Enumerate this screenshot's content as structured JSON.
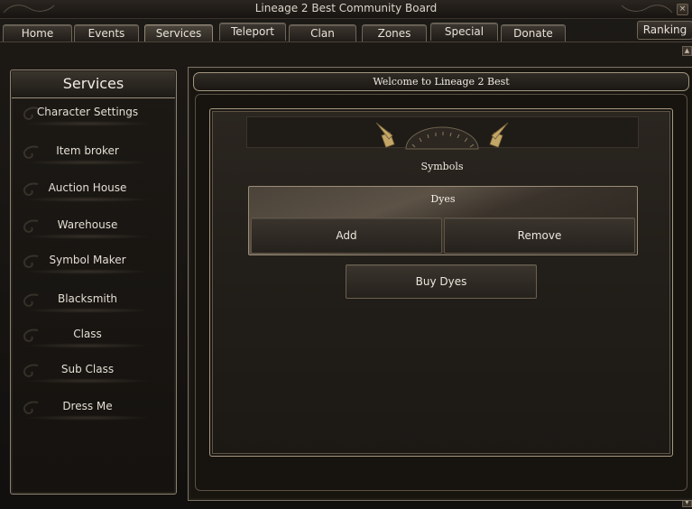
{
  "window": {
    "title": "Lineage 2 Best Community Board"
  },
  "tabs": [
    {
      "label": "Home"
    },
    {
      "label": "Events"
    },
    {
      "label": "Services"
    },
    {
      "label": "Teleport"
    },
    {
      "label": "Clan"
    },
    {
      "label": "Zones"
    },
    {
      "label": "Special"
    },
    {
      "label": "Donate"
    }
  ],
  "active_tab": "Services",
  "ranking": {
    "label": "Ranking"
  },
  "sidebar": {
    "title": "Services",
    "items": [
      {
        "label": "Character Settings"
      },
      {
        "label": "Item broker"
      },
      {
        "label": "Auction House"
      },
      {
        "label": "Warehouse"
      },
      {
        "label": "Symbol Maker"
      },
      {
        "label": "Blacksmith"
      },
      {
        "label": "Class"
      },
      {
        "label": "Sub Class"
      },
      {
        "label": "Dress Me"
      }
    ]
  },
  "main": {
    "welcome": "Welcome to Lineage 2 Best",
    "section_title": "Symbols",
    "dyes": {
      "title": "Dyes",
      "add_label": "Add",
      "remove_label": "Remove"
    },
    "buy_label": "Buy Dyes"
  },
  "icons": {
    "close": "close-icon",
    "scroll_up": "scroll-up-icon",
    "scroll_down": "scroll-down-icon",
    "menu_swirl": "swirl-icon",
    "emblem": "axes-emblem-icon"
  },
  "colors": {
    "background": "#141210",
    "border_accent": "#a39680",
    "text": "#e6e1d6"
  }
}
